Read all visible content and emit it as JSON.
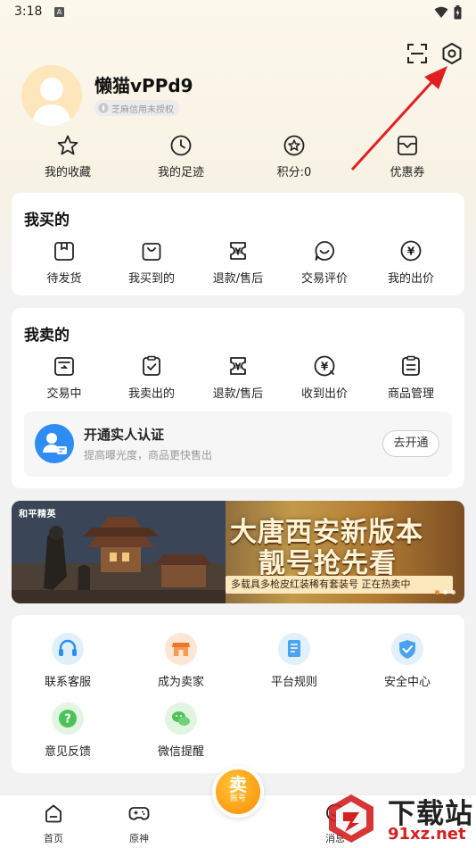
{
  "status_bar": {
    "time": "3:18",
    "indicator": "A"
  },
  "header": {
    "scan_icon": "scan-icon",
    "settings_icon": "gear-icon",
    "username": "懒猫vPPd9",
    "credit_status": "芝麻信用未授权"
  },
  "quick_links": [
    {
      "label": "我的收藏",
      "icon": "star-icon"
    },
    {
      "label": "我的足迹",
      "icon": "clock-icon"
    },
    {
      "label": "积分:0",
      "icon": "points-icon"
    },
    {
      "label": "优惠券",
      "icon": "coupon-icon"
    }
  ],
  "bought": {
    "title": "我买的",
    "items": [
      {
        "label": "待发货",
        "icon": "box-icon"
      },
      {
        "label": "我买到的",
        "icon": "bag-icon"
      },
      {
        "label": "退款/售后",
        "icon": "refund-icon"
      },
      {
        "label": "交易评价",
        "icon": "review-icon"
      },
      {
        "label": "我的出价",
        "icon": "bid-icon"
      }
    ]
  },
  "sold": {
    "title": "我卖的",
    "items": [
      {
        "label": "交易中",
        "icon": "trading-icon"
      },
      {
        "label": "我卖出的",
        "icon": "clipboard-check-icon"
      },
      {
        "label": "退款/售后",
        "icon": "refund-icon"
      },
      {
        "label": "收到出价",
        "icon": "received-bid-icon"
      },
      {
        "label": "商品管理",
        "icon": "manage-icon"
      }
    ],
    "verify": {
      "title": "开通实人认证",
      "subtitle": "提高曝光度，商品更快售出",
      "button": "去开通"
    }
  },
  "banner": {
    "logo": "和平精英",
    "title_line1": "大唐西安新版本",
    "title_line2": "靓号抢先看",
    "tagline": "多载具多枪皮红装稀有套装号 正在热卖中"
  },
  "services": [
    {
      "label": "联系客服",
      "icon": "headset-icon",
      "color": "#dff0fb"
    },
    {
      "label": "成为卖家",
      "icon": "shop-icon",
      "color": "#fde6d4"
    },
    {
      "label": "平台规则",
      "icon": "document-icon",
      "color": "#e1f0fb"
    },
    {
      "label": "安全中心",
      "icon": "shield-icon",
      "color": "#e1f0fb"
    },
    {
      "label": "意见反馈",
      "icon": "question-icon",
      "color": "#e2f5e2"
    },
    {
      "label": "微信提醒",
      "icon": "wechat-icon",
      "color": "#e2f5e2"
    }
  ],
  "bottom_nav": {
    "items": [
      {
        "label": "首页",
        "icon": "home-icon"
      },
      {
        "label": "原神",
        "icon": "gamepad-icon"
      },
      {
        "label": "消息",
        "icon": "message-icon"
      }
    ],
    "sell_main": "卖",
    "sell_sub": "账号"
  },
  "watermark": {
    "line1": "下载站",
    "line2": "91xz.net"
  },
  "colors": {
    "accent_orange": "#ff9d13",
    "verify_blue": "#2f8cf3",
    "annotation_red": "#e02020"
  }
}
